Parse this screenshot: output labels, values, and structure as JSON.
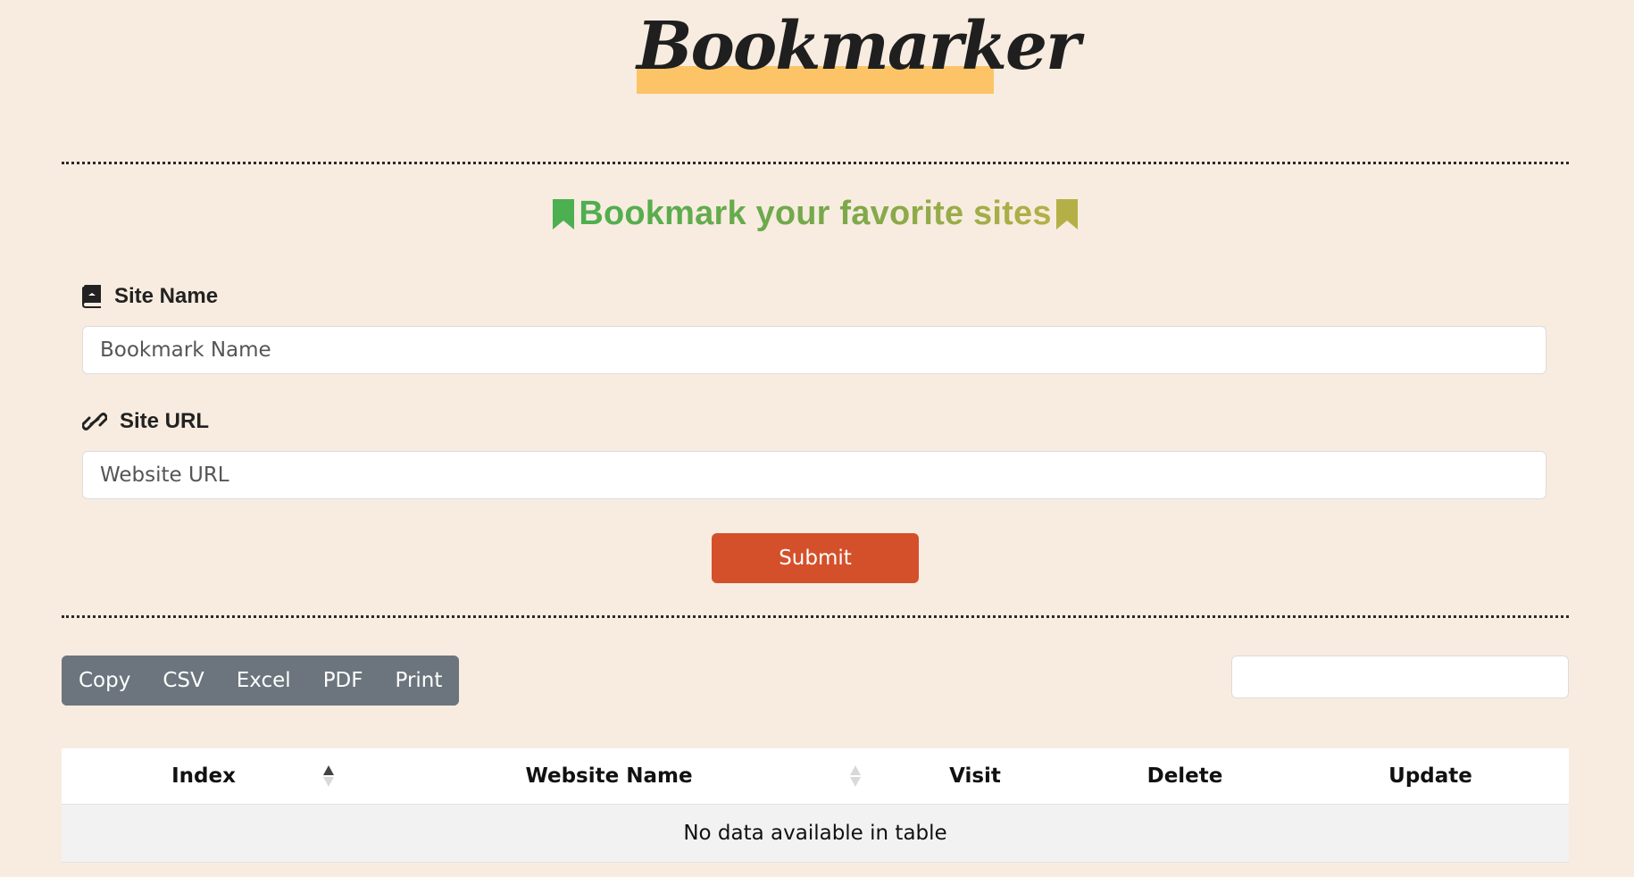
{
  "header": {
    "logo_text": "Bookmarker",
    "logo_highlight_color": "#fcc466"
  },
  "subtitle": {
    "text": "Bookmark your favorite sites",
    "icon_left": "bookmark-icon",
    "icon_right": "bookmark-icon",
    "color_start": "#4caf50",
    "color_end": "#b4b047"
  },
  "form": {
    "site_name": {
      "label": "Site Name",
      "icon": "book-icon",
      "placeholder": "Bookmark Name",
      "value": ""
    },
    "site_url": {
      "label": "Site URL",
      "icon": "link-icon",
      "placeholder": "Website URL",
      "value": ""
    },
    "submit_label": "Submit",
    "submit_color": "#d4502b"
  },
  "toolbar": {
    "buttons": [
      "Copy",
      "CSV",
      "Excel",
      "PDF",
      "Print"
    ],
    "button_color": "#6c757d",
    "search_value": ""
  },
  "table": {
    "columns": [
      "Index",
      "Website Name",
      "Visit",
      "Delete",
      "Update"
    ],
    "sorted_column": "Index",
    "sort_direction": "ascending",
    "empty_message": "No data available in table"
  },
  "page_background": "#f8ece0"
}
